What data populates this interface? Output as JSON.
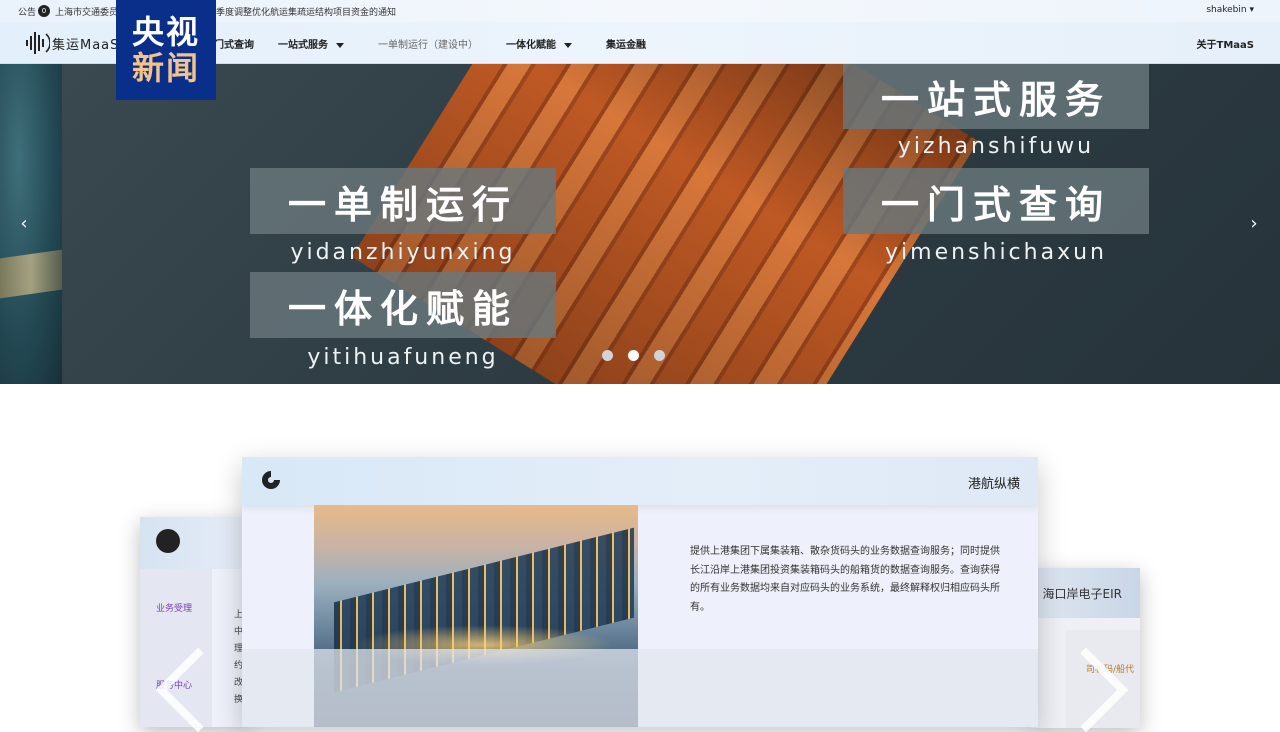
{
  "topbar": {
    "announce_label": "公告",
    "announce_count": "0",
    "notice_left": "上海市交通委员",
    "notice_right": "季度调整优化航运集疏运结构项目资金的通知",
    "user": "shakebin"
  },
  "nav": {
    "brand": "集运MaaS",
    "items": [
      {
        "label": "门式查询"
      },
      {
        "label": "一站式服务"
      },
      {
        "label": "一单制运行（建设中）"
      },
      {
        "label": "一体化赋能"
      },
      {
        "label": "集运金融"
      }
    ],
    "about": "关于TMaaS"
  },
  "watermark": {
    "line1": "央视",
    "line2": "新闻"
  },
  "banner": {
    "tiles": [
      {
        "text": "一站式服务",
        "pinyin": "yizhanshifuwu"
      },
      {
        "text": "一单制运行",
        "pinyin": "yidanzhiyunxing"
      },
      {
        "text": "一门式查询",
        "pinyin": "yimenshichaxun"
      },
      {
        "text": "一体化赋能",
        "pinyin": "yitihuafuneng"
      }
    ],
    "prev": "‹",
    "next": "›",
    "active_slide": 2
  },
  "services": {
    "main": {
      "title": "港航纵横",
      "description": "提供上港集团下属集装箱、散杂货码头的业务数据查询服务；同时提供长江沿岸上港集团投资集装箱码头的船箱货的数据查询服务。查询获得的所有业务数据均来自对应码头的业务系统，最终解释权归相应码头所有。"
    },
    "left": {
      "items": [
        "业务受理",
        "服务中心"
      ],
      "snippet": [
        "上",
        "中",
        "理",
        "约",
        "改",
        "换"
      ]
    },
    "right": {
      "title": "海口岸电子EIR",
      "side_text": "司机码/船代"
    }
  }
}
